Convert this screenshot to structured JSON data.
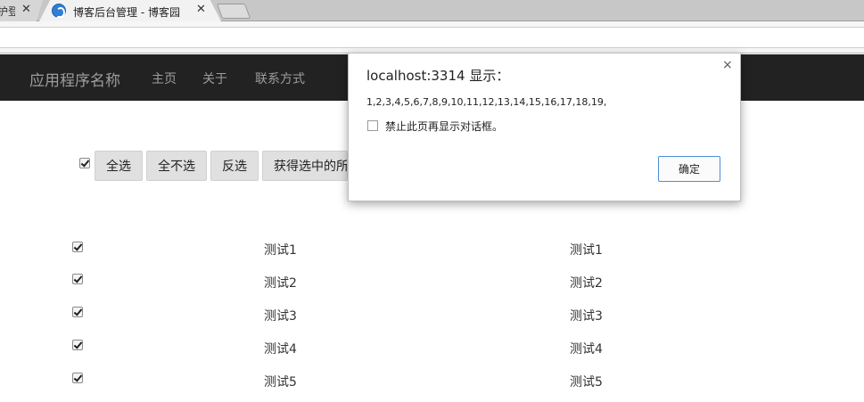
{
  "browser": {
    "tabs": [
      {
        "title": "护登",
        "close": "✕"
      },
      {
        "title": "博客后台管理 - 博客园",
        "close": "✕"
      }
    ]
  },
  "navbar": {
    "brand": "应用程序名称",
    "links": [
      "主页",
      "关于",
      "联系方式"
    ]
  },
  "toolbar": {
    "select_all_label": "全选",
    "select_none_label": "全不选",
    "invert_label": "反选",
    "get_selected_label": "获得选中的所"
  },
  "rows": [
    {
      "checked": true,
      "col1": "测试1",
      "col2": "测试1"
    },
    {
      "checked": true,
      "col1": "测试2",
      "col2": "测试2"
    },
    {
      "checked": true,
      "col1": "测试3",
      "col2": "测试3"
    },
    {
      "checked": true,
      "col1": "测试4",
      "col2": "测试4"
    },
    {
      "checked": true,
      "col1": "测试5",
      "col2": "测试5"
    }
  ],
  "dialog": {
    "title": "localhost:3314 显示：",
    "close": "×",
    "message": "1,2,3,4,5,6,7,8,9,10,11,12,13,14,15,16,17,18,19,",
    "suppress_label": "禁止此页再显示对话框。",
    "ok_label": "确定"
  },
  "colors": {
    "navbar_bg": "#222222",
    "navbar_text": "#9d9d9d",
    "button_bg": "#e0e0e0",
    "ok_border": "#4a90d9"
  }
}
